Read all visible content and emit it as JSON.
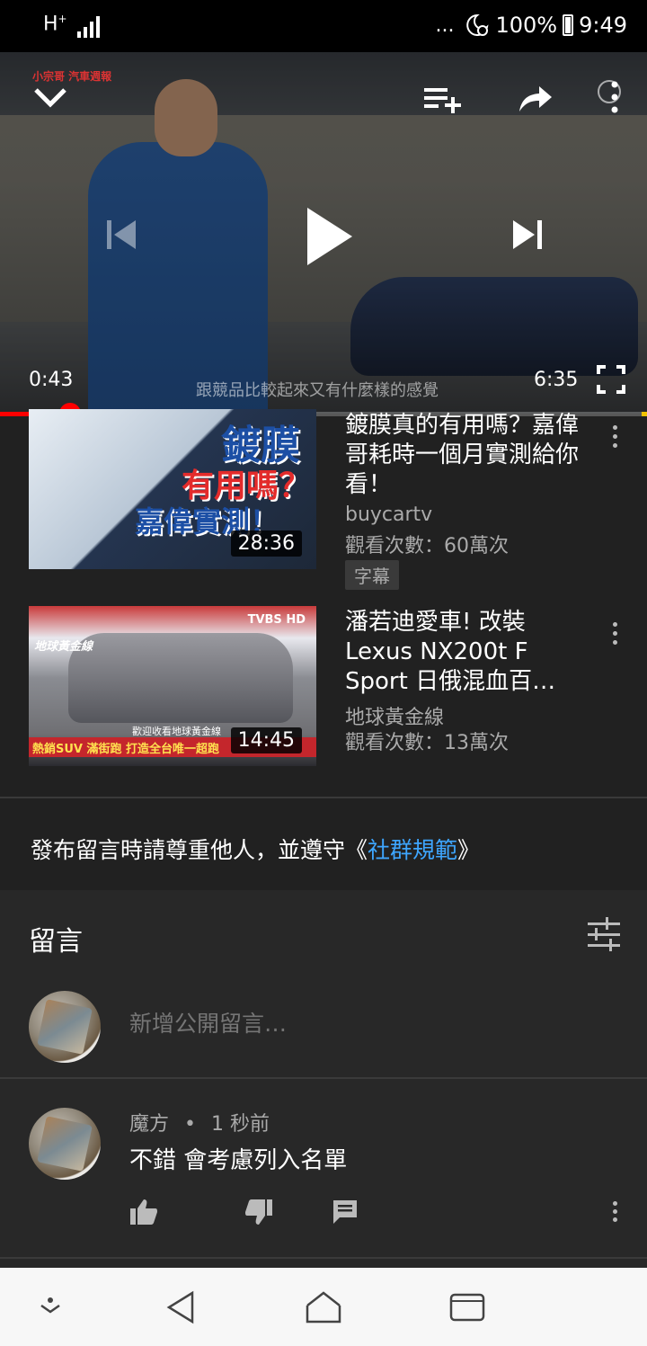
{
  "status_bar": {
    "network": "H",
    "network_sup": "+",
    "dots": "...",
    "battery": "100%",
    "time": "9:49"
  },
  "player": {
    "logo": "小宗哥 汽車週報",
    "current_time": "0:43",
    "duration": "6:35",
    "caption": "跟競品比較起來又有什麼樣的感覺",
    "progress": 0.108,
    "accent": "#ff0000"
  },
  "related": [
    {
      "title": "鍍膜真的有用嗎？嘉偉哥耗時一個月實測給你看！",
      "channel": "buycartv",
      "views": "觀看次數：60萬次",
      "badge": "字幕",
      "duration": "28:36",
      "thumb_text": [
        "鍍膜",
        "有用嗎？",
        "嘉偉實測！"
      ]
    },
    {
      "title": "潘若迪愛車! 改裝Lexus NX200t F Sport 日俄混血百…",
      "channel": "地球黃金線",
      "views": "觀看次數：13萬次",
      "duration": "14:45",
      "thumb_text": [
        "地球黃金線",
        "TVBS HD",
        "歡迎收看地球黃金線",
        "熱銷SUV 滿街跑 打造全台唯一超跑"
      ]
    }
  ],
  "notice": {
    "prefix": "發布留言時請尊重他人，並遵守《",
    "link": "社群規範",
    "suffix": "》"
  },
  "comments": {
    "title": "留言",
    "add_placeholder": "新增公開留言…",
    "items": [
      {
        "author": "魔方",
        "separator": "•",
        "time": "1 秒前",
        "text": "不錯 會考慮列入名單"
      }
    ]
  }
}
